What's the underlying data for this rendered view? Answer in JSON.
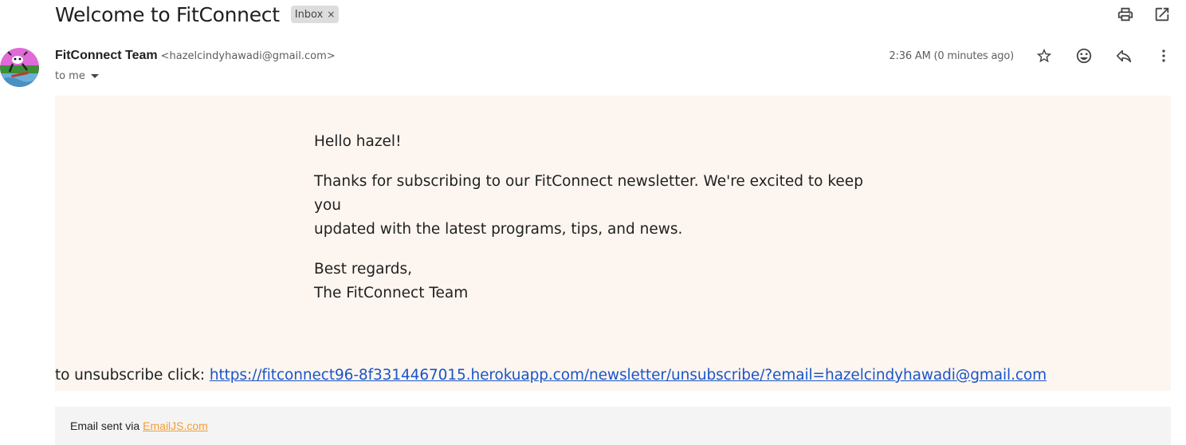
{
  "subject": "Welcome to FitConnect",
  "label": {
    "name": "Inbox",
    "remove": "×"
  },
  "top_actions": [
    "print-icon",
    "open-in-new-window-icon"
  ],
  "sender": {
    "name": "FitConnect Team",
    "email": "<hazelcindyhawadi@gmail.com>",
    "to": "to me"
  },
  "timestamp": "2:36 AM (0 minutes ago)",
  "message_actions": [
    "star-icon",
    "emoji-icon",
    "reply-icon",
    "more-vert-icon"
  ],
  "body": {
    "greeting": "Hello hazel!",
    "paragraph_line1": "Thanks for subscribing to our FitConnect newsletter. We're excited to keep you",
    "paragraph_line2": "updated with the latest programs, tips, and news.",
    "signoff": "Best regards,",
    "signature": "The FitConnect Team",
    "unsubscribe_prefix": "to unsubscribe click: ",
    "unsubscribe_link": "https://fitconnect96-8f3314467015.herokuapp.com/newsletter/unsubscribe/?email=hazelcindyhawadi@gmail.com"
  },
  "footer": {
    "prefix": "Email sent via",
    "link": "EmailJS.com"
  },
  "colors": {
    "body_background": "#fdf6f0",
    "link": "#1a55c8",
    "footer_link": "#f59c33",
    "footer_background": "#f4f4f4",
    "label_chip": "#dddddd"
  }
}
